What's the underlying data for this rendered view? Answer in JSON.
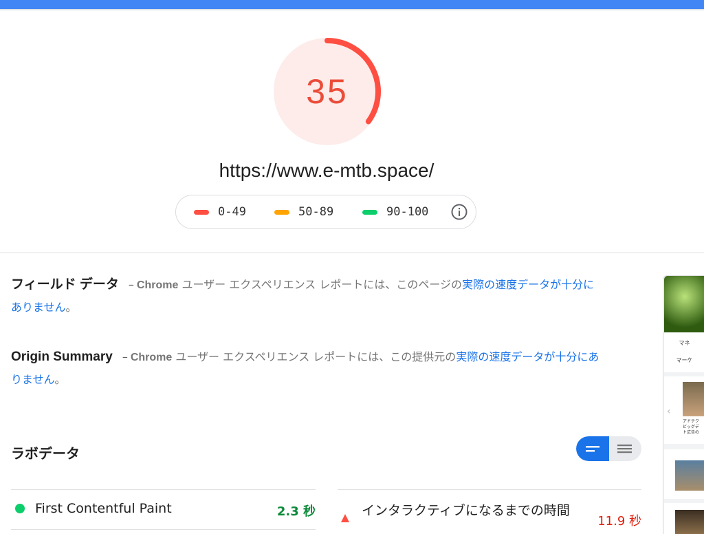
{
  "colors": {
    "accent_bar": "#4285f4",
    "fail": "#ff4e42",
    "average": "#ffa400",
    "pass": "#0cce6b",
    "link": "#1a73e8"
  },
  "score": {
    "value": "35",
    "fraction": 0.35
  },
  "url": "https://www.e-mtb.space/",
  "legend": {
    "items": [
      {
        "label": "0-49",
        "color": "#ff4e42"
      },
      {
        "label": "50-89",
        "color": "#ffa400"
      },
      {
        "label": "90-100",
        "color": "#0cce6b"
      }
    ],
    "info_icon": "info-icon"
  },
  "field_data": {
    "title": "フィールド データ",
    "dash": "–",
    "chrome": "Chrome",
    "text": " ユーザー エクスペリエンス レポートには、このページの",
    "link": "実際の速度データが十分にありません",
    "end": "。"
  },
  "origin_summary": {
    "title": "Origin Summary",
    "dash": "–",
    "chrome": "Chrome",
    "text": " ユーザー エクスペリエンス レポートには、この提供元の",
    "link": "実際の速度データが十分にありません",
    "end": "。"
  },
  "lab": {
    "title": "ラボデータ",
    "metrics": [
      {
        "label": "First Contentful Paint",
        "value": "2.3 秒",
        "status": "pass"
      },
      {
        "label": "インタラクティブになるまでの時間",
        "value": "11.9 秒",
        "status": "fail"
      }
    ]
  },
  "thumbnail_text": {
    "line1": "マネ",
    "line2": "マーケ",
    "ad_line1": "アドテク",
    "ad_line2": "ビッグデ",
    "ad_line3": "ト広告の"
  }
}
